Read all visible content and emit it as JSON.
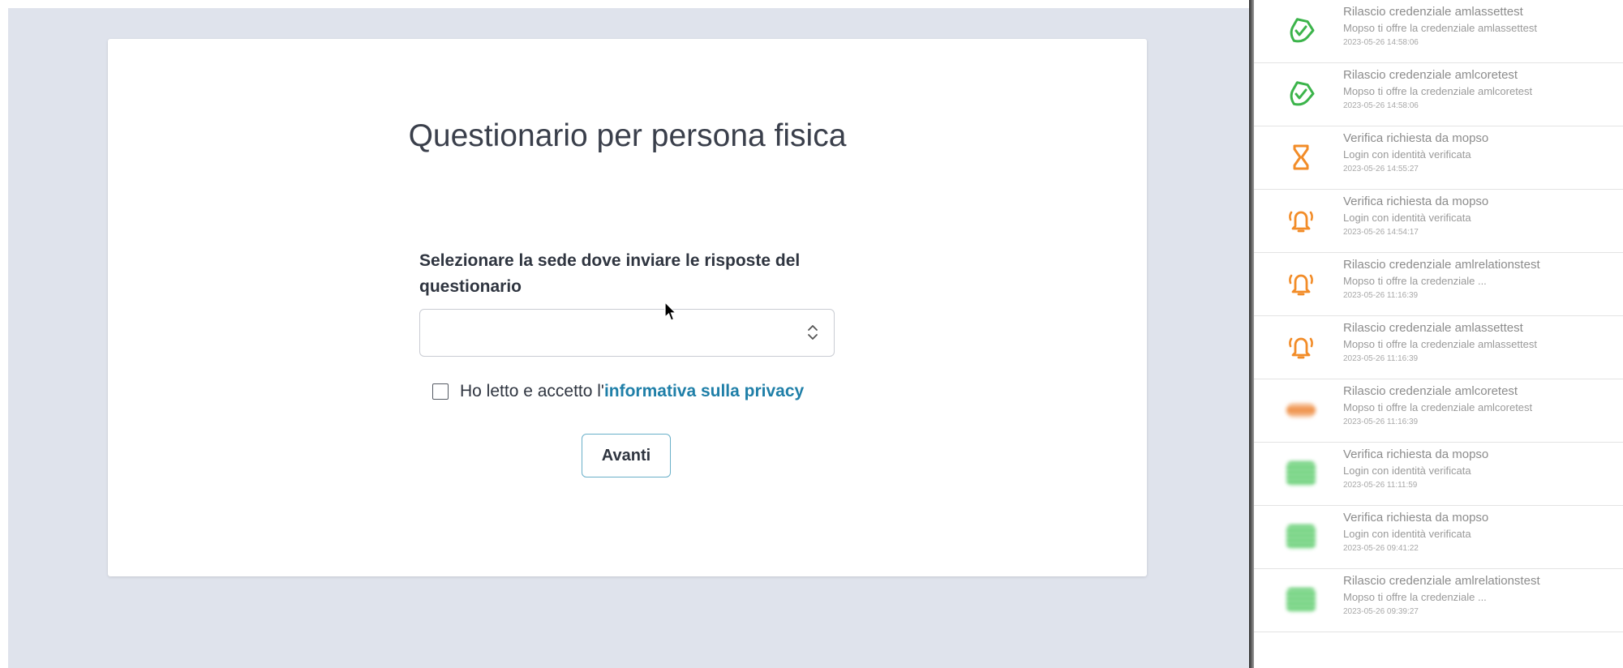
{
  "form": {
    "title": "Questionario per persona fisica",
    "select_label": "Selezionare la sede dove inviare le risposte del questionario",
    "select_value": "",
    "privacy_prefix": "Ho letto e accetto l'",
    "privacy_link": "informativa sulla privacy",
    "next_label": "Avanti"
  },
  "notifications": [
    {
      "title": "Rilascio credenziale amlassettest",
      "subtitle": "Mopso ti offre la credenziale amlassettest",
      "time": "2023-05-26 14:58:06",
      "icon": "shield-check-icon",
      "color": "#3cb44b"
    },
    {
      "title": "Rilascio credenziale amlcoretest",
      "subtitle": "Mopso ti offre la credenziale amlcoretest",
      "time": "2023-05-26 14:58:06",
      "icon": "shield-check-icon",
      "color": "#3cb44b"
    },
    {
      "title": "Verifica richiesta da mopso",
      "subtitle": "Login con identità verificata",
      "time": "2023-05-26 14:55:27",
      "icon": "hourglass-icon",
      "color": "#f28c28"
    },
    {
      "title": "Verifica richiesta da mopso",
      "subtitle": "Login con identità verificata",
      "time": "2023-05-26 14:54:17",
      "icon": "alarm-bell-icon",
      "color": "#f28c28"
    },
    {
      "title": "Rilascio credenziale amlrelationstest",
      "subtitle": "Mopso ti offre la credenziale ...",
      "time": "2023-05-26 11:16:39",
      "icon": "alarm-bell-icon",
      "color": "#f28c28"
    },
    {
      "title": "Rilascio credenziale amlassettest",
      "subtitle": "Mopso ti offre la credenziale amlassettest",
      "time": "2023-05-26 11:16:39",
      "icon": "alarm-bell-icon",
      "color": "#f28c28"
    },
    {
      "title": "Rilascio credenziale amlcoretest",
      "subtitle": "Mopso ti offre la credenziale amlcoretest",
      "time": "2023-05-26 11:16:39",
      "icon": "blurred-orange-icon",
      "color": "#f28c28"
    },
    {
      "title": "Verifica richiesta da mopso",
      "subtitle": "Login con identità verificata",
      "time": "2023-05-26 11:11:59",
      "icon": "blurred-green-icon",
      "color": "#3cb44b"
    },
    {
      "title": "Verifica richiesta da mopso",
      "subtitle": "Login con identità verificata",
      "time": "2023-05-26 09:41:22",
      "icon": "blurred-green-icon",
      "color": "#3cb44b"
    },
    {
      "title": "Rilascio credenziale amlrelationstest",
      "subtitle": "Mopso ti offre la credenziale ...",
      "time": "2023-05-26 09:39:27",
      "icon": "blurred-green-icon",
      "color": "#3cb44b"
    }
  ]
}
